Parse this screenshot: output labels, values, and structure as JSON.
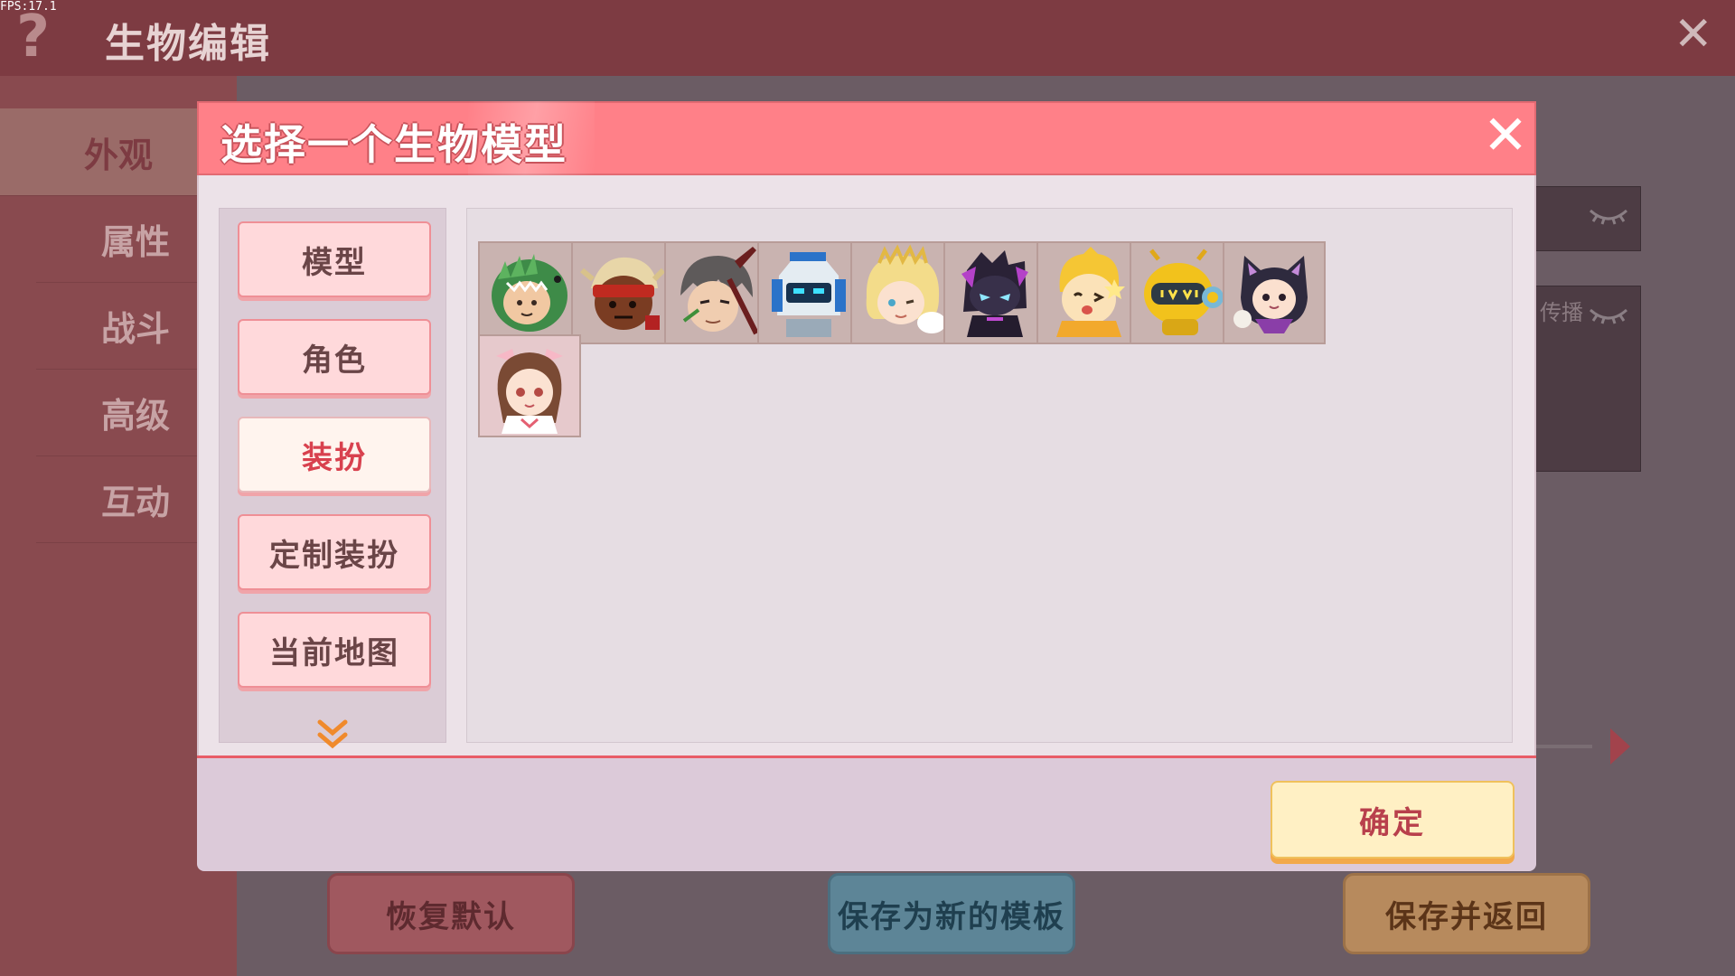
{
  "fps": "FPS:17.1",
  "background": {
    "title": "生物编辑",
    "help_glyph": "?",
    "close_glyph": "✕",
    "sidebar": [
      {
        "label": "外观",
        "active": true
      },
      {
        "label": "属性",
        "active": false
      },
      {
        "label": "战斗",
        "active": false
      },
      {
        "label": "高级",
        "active": false
      },
      {
        "label": "互动",
        "active": false
      }
    ],
    "partial_text": "传播",
    "buttons": {
      "restore": "恢复默认",
      "save_template": "保存为新的模板",
      "save_return": "保存并返回"
    }
  },
  "modal": {
    "title": "选择一个生物模型",
    "close_glyph": "✕",
    "categories": [
      {
        "label": "模型",
        "active": false
      },
      {
        "label": "角色",
        "active": false
      },
      {
        "label": "装扮",
        "active": true
      },
      {
        "label": "定制装扮",
        "active": false
      },
      {
        "label": "当前地图",
        "active": false
      }
    ],
    "more_glyph": "︾",
    "items": [
      {
        "icon": "dino-hood-character-icon"
      },
      {
        "icon": "red-bandana-character-icon"
      },
      {
        "icon": "gray-hair-swordsman-icon"
      },
      {
        "icon": "blue-mecha-robot-icon"
      },
      {
        "icon": "blonde-angel-girl-icon"
      },
      {
        "icon": "purple-shadow-knight-icon"
      },
      {
        "icon": "golden-star-character-icon"
      },
      {
        "icon": "yellow-round-robot-icon"
      },
      {
        "icon": "black-cat-hood-character-icon"
      },
      {
        "icon": "pink-bow-girl-icon"
      }
    ],
    "confirm": "确定"
  },
  "colors": {
    "header": "#ff8088",
    "accent_red": "#d8414e",
    "confirm_bg": "#fff0c4"
  }
}
